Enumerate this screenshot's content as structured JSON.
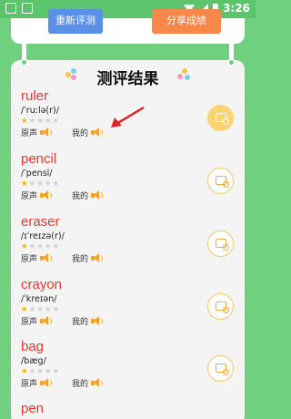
{
  "status_bar": {
    "time": "3:26"
  },
  "top": {
    "retest_label": "重新评测",
    "share_label": "分享成绩"
  },
  "card": {
    "title": "测评结果"
  },
  "labels": {
    "original": "原声",
    "mine": "我的"
  },
  "words": [
    {
      "word": "ruler",
      "phonetic": "/ˈruːlə(r)/",
      "stars": 1,
      "total_stars": 5,
      "selected": true
    },
    {
      "word": "pencil",
      "phonetic": "/ˈpensl/",
      "stars": 1,
      "total_stars": 5,
      "selected": false
    },
    {
      "word": "eraser",
      "phonetic": "/ɪˈreɪzə(r)/",
      "stars": 1,
      "total_stars": 5,
      "selected": false
    },
    {
      "word": "crayon",
      "phonetic": "/ˈkreɪən/",
      "stars": 1,
      "total_stars": 5,
      "selected": false
    },
    {
      "word": "bag",
      "phonetic": "/bæg/",
      "stars": 1,
      "total_stars": 5,
      "selected": false
    },
    {
      "word": "pen",
      "phonetic": "",
      "stars": 0,
      "total_stars": 5,
      "selected": false
    }
  ],
  "colors": {
    "background": "#6fd07f",
    "word": "#e83a30",
    "star_on": "#f5b400",
    "speaker": "#f7a325",
    "annotation_arrow": "#e02020"
  },
  "icons": {
    "speaker": "speaker-icon",
    "share_card": "share-card-icon",
    "arrow": "red-arrow-annotation"
  }
}
